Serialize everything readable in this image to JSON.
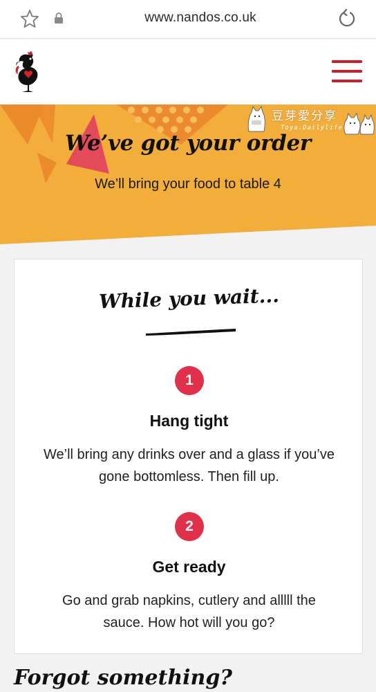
{
  "browser": {
    "url": "www.nandos.co.uk",
    "icons": [
      "star-icon",
      "lock-icon",
      "reload-icon"
    ]
  },
  "header": {
    "logo": "nandos-cockerel-logo",
    "menu_icon": "hamburger-menu-icon",
    "accent_color": "#c8202f"
  },
  "hero": {
    "title": "We’ve got your order",
    "subtitle": "We’ll bring your food to table 4",
    "background_color": "#f3ad3b",
    "watermark": {
      "text": "豆芽愛分享",
      "sub": "Toya.Dailylife"
    }
  },
  "card": {
    "title": "While you wait...",
    "steps": [
      {
        "number": "1",
        "title": "Hang tight",
        "description": "We’ll bring any drinks over and a glass if you’ve gone bottomless. Then fill up."
      },
      {
        "number": "2",
        "title": "Get ready",
        "description": "Go and grab napkins, cutlery and alllll the sauce. How hot will you go?"
      }
    ],
    "badge_color": "#e1314a"
  },
  "forgot": {
    "heading": "Forgot something?"
  }
}
